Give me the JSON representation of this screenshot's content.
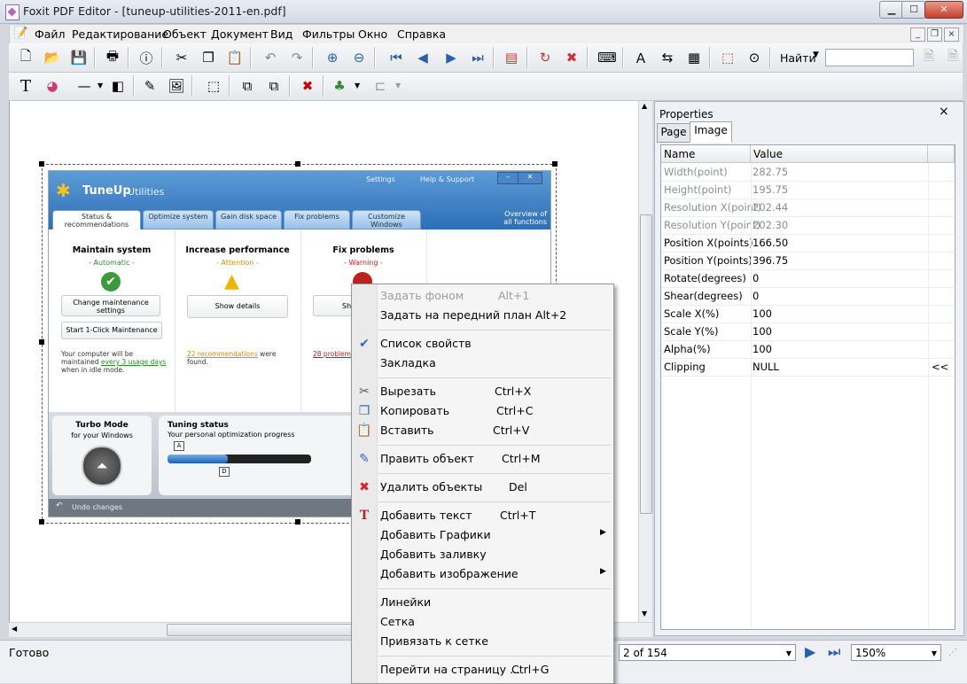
{
  "window": {
    "title": "Foxit PDF Editor - [tuneup-utilities-2011-en.pdf]"
  },
  "menu": [
    "Файл",
    "Редактирование",
    "Объект",
    "Документ",
    "Вид",
    "Фильтры",
    "Окно",
    "Справка"
  ],
  "toolbar": {
    "find_label": "Найти"
  },
  "embedded_image": {
    "logo": "TuneUp",
    "logo_suffix": "Utilities",
    "top_links": [
      "Settings",
      "Help & Support"
    ],
    "tabs": [
      "Status & recommendations",
      "Optimize system",
      "Gain disk space",
      "Fix problems",
      "Customize Windows"
    ],
    "overview": "Overview of all functions",
    "columns": [
      {
        "title": "Maintain system",
        "status": "- Automatic -",
        "status_color": "#2e8b2e",
        "button": "Change maintenance settings"
      },
      {
        "title": "Increase performance",
        "status": "- Attention -",
        "status_color": "#e08a00",
        "button": "Show details"
      },
      {
        "title": "Fix problems",
        "status": "- Warning -",
        "status_color": "#c0201b",
        "button": "Sho"
      }
    ],
    "oneclick": "Start 1-Click Maintenance",
    "note1_a": "Your computer will be maintained ",
    "note1_link": "every 3 usage days",
    "note1_b": " when in idle mode.",
    "note2_link": "22 recommendations",
    "note2_b": " were found.",
    "note3_link": "28 problems",
    "turbo_title": "Turbo Mode",
    "turbo_sub": "for your Windows",
    "tuning_title": "Tuning status",
    "tuning_sub": "Your personal optimization progress",
    "marker_a": "A",
    "marker_d": "D",
    "undo": "Undo changes"
  },
  "properties": {
    "title": "Properties",
    "tabs": [
      "Page",
      "Image"
    ],
    "headers": [
      "Name",
      "Value"
    ],
    "rows": [
      {
        "name": "Width(point)",
        "value": "282.75",
        "disabled": true
      },
      {
        "name": "Height(point)",
        "value": "195.75",
        "disabled": true
      },
      {
        "name": "Resolution X(point)",
        "value": "202.44",
        "disabled": true
      },
      {
        "name": "Resolution Y(point)",
        "value": "202.30",
        "disabled": true
      },
      {
        "name": "Position X(points)",
        "value": "166.50",
        "disabled": false
      },
      {
        "name": "Position Y(points)",
        "value": "396.75",
        "disabled": false
      },
      {
        "name": "Rotate(degrees)",
        "value": "0",
        "disabled": false
      },
      {
        "name": "Shear(degrees)",
        "value": "0",
        "disabled": false
      },
      {
        "name": "Scale X(%)",
        "value": "100",
        "disabled": false
      },
      {
        "name": "Scale Y(%)",
        "value": "100",
        "disabled": false
      },
      {
        "name": "Alpha(%)",
        "value": "100",
        "disabled": false
      },
      {
        "name": "Clipping",
        "value": "NULL",
        "disabled": false,
        "extra": "<<"
      }
    ]
  },
  "status": {
    "text": "Готово",
    "page": "2 of 154",
    "zoom": "150%"
  },
  "context_menu": {
    "items": [
      {
        "label": "Задать фоном",
        "shortcut": "Alt+1",
        "disabled": true,
        "icon": ""
      },
      {
        "label": "Задать на передний план Alt+2",
        "shortcut": "",
        "disabled": false,
        "icon": ""
      },
      {
        "label": "Список свойств",
        "shortcut": "",
        "disabled": false,
        "icon": "✔"
      },
      {
        "label": "Закладка",
        "shortcut": "",
        "disabled": false,
        "icon": ""
      },
      {
        "label": "Вырезать",
        "shortcut": "Ctrl+X",
        "disabled": false,
        "icon": "✂"
      },
      {
        "label": "Копировать",
        "shortcut": "Ctrl+C",
        "disabled": false,
        "icon": "❐"
      },
      {
        "label": "Вставить",
        "shortcut": "Ctrl+V",
        "disabled": false,
        "icon": "📋"
      },
      {
        "label": "Править объект",
        "shortcut": "Ctrl+M",
        "disabled": false,
        "icon": "✎"
      },
      {
        "label": "Удалить объекты",
        "shortcut": "Del",
        "disabled": false,
        "icon": "✖"
      },
      {
        "label": "Добавить текст",
        "shortcut": "Ctrl+T",
        "disabled": false,
        "icon": "T"
      },
      {
        "label": "Добавить Графики",
        "shortcut": "",
        "disabled": false,
        "icon": "",
        "submenu": true
      },
      {
        "label": "Добавить заливку",
        "shortcut": "",
        "disabled": false,
        "icon": ""
      },
      {
        "label": "Добавить изображение",
        "shortcut": "",
        "disabled": false,
        "icon": "",
        "submenu": true
      },
      {
        "label": "Линейки",
        "shortcut": "",
        "disabled": false,
        "icon": ""
      },
      {
        "label": "Сетка",
        "shortcut": "",
        "disabled": false,
        "icon": ""
      },
      {
        "label": "Привязать к сетке",
        "shortcut": "",
        "disabled": false,
        "icon": ""
      },
      {
        "label": "Перейти на страницу ...",
        "shortcut": "Ctrl+G",
        "disabled": false,
        "icon": ""
      }
    ]
  },
  "colors": {
    "accent": "#3a6fb0",
    "titlebar": "#d3dbe6"
  }
}
